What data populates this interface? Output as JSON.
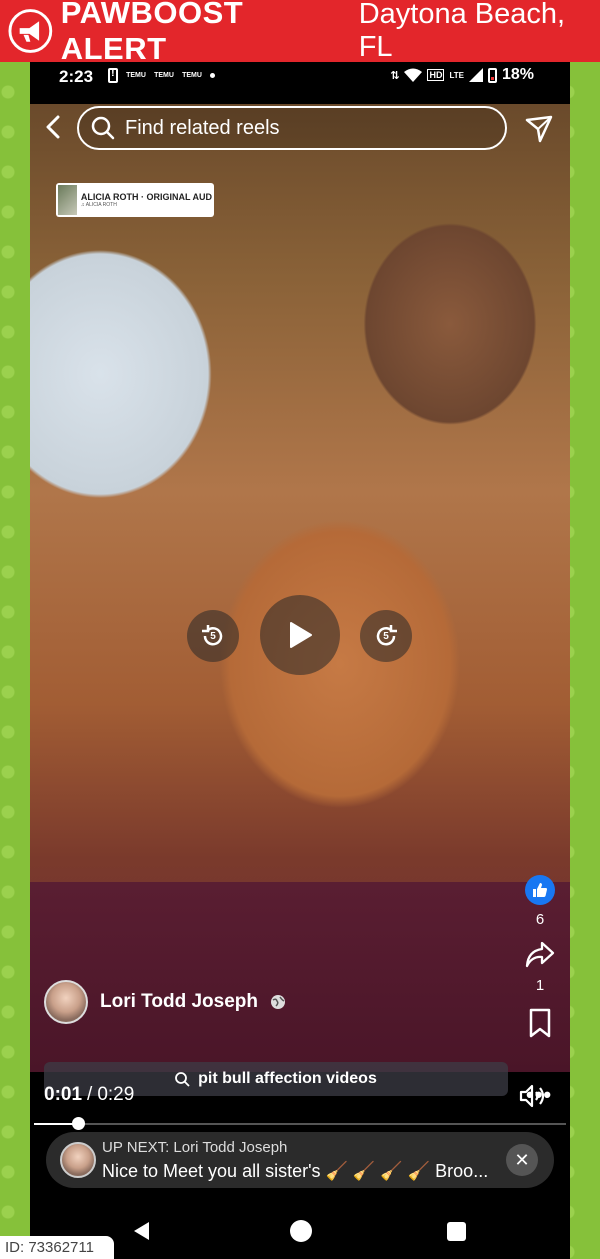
{
  "banner": {
    "title": "PAWBOOST ALERT",
    "location": "Daytona Beach, FL",
    "color": "#e3262b"
  },
  "status_bar": {
    "time": "2:23",
    "app_icons": [
      "TEMU",
      "TEMU",
      "TEMU"
    ],
    "network": "HD",
    "network_type": "LTE",
    "battery": "18%"
  },
  "reel": {
    "search_placeholder": "Find related reels",
    "audio_title": "ALICIA ROTH · ORIGINAL AUD",
    "audio_sub": "♫ ALICIA ROTH",
    "skip_back_seconds": "5",
    "skip_forward_seconds": "5",
    "like_count": "6",
    "share_count": "1",
    "author_name": "Lori Todd Joseph",
    "related_search": "pit bull affection videos",
    "time_current": "0:01",
    "time_separator": "/",
    "time_total": "0:29",
    "progress_fraction": 0.034,
    "more_label": "•••"
  },
  "up_next": {
    "label": "UP NEXT: Lori Todd Joseph",
    "title": "Nice to Meet you all sister's 🧹 🧹 🧹 🧹 Broo...",
    "close_label": "✕"
  },
  "footer": {
    "id_label": "ID: 73362711"
  },
  "accent_colors": {
    "like_blue": "#1877f2",
    "background_green": "#86c13a"
  }
}
